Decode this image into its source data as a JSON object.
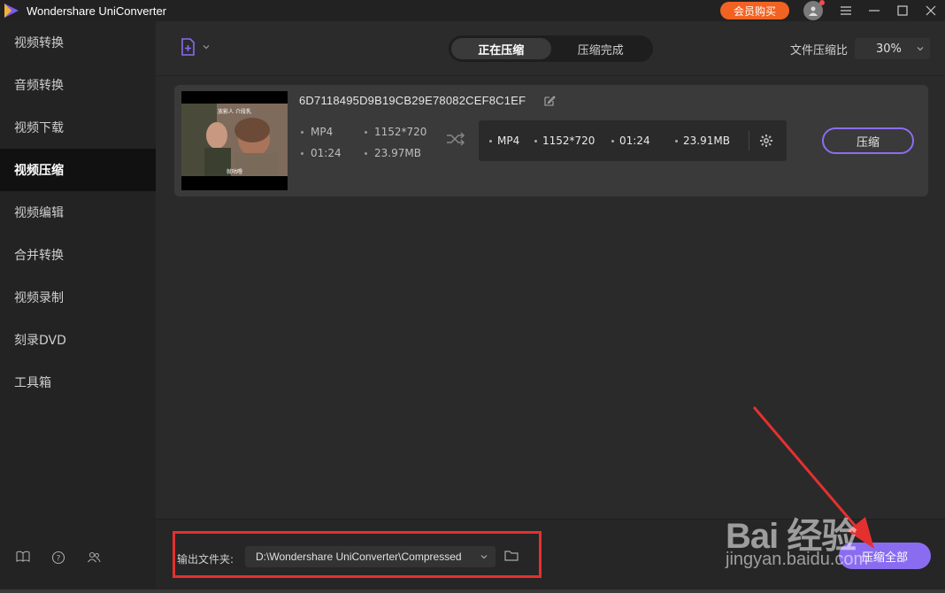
{
  "window": {
    "title": "Wondershare UniConverter",
    "vip_label": "会员购买"
  },
  "sidebar": {
    "items": [
      {
        "label": "视频转换",
        "active": false
      },
      {
        "label": "音频转换",
        "active": false
      },
      {
        "label": "视频下载",
        "active": false
      },
      {
        "label": "视频压缩",
        "active": true
      },
      {
        "label": "视频编辑",
        "active": false
      },
      {
        "label": "合并转换",
        "active": false
      },
      {
        "label": "视频录制",
        "active": false
      },
      {
        "label": "刻录DVD",
        "active": false
      },
      {
        "label": "工具箱",
        "active": false
      }
    ],
    "footer_icons": [
      "book-icon",
      "help-icon",
      "users-icon"
    ]
  },
  "toolbar": {
    "tabs": [
      {
        "label": "正在压缩",
        "active": true
      },
      {
        "label": "压缩完成",
        "active": false
      }
    ],
    "ratio_label": "文件压缩比",
    "ratio_value": "30%"
  },
  "file": {
    "name": "6D7118495D9B19CB29E78082CEF8C1EF",
    "thumb_caption_top": "放影人 介段乳",
    "thumb_caption_bottom": "就咕噜",
    "source": {
      "format": "MP4",
      "resolution": "1152*720",
      "duration": "01:24",
      "size": "23.97MB"
    },
    "target": {
      "format": "MP4",
      "resolution": "1152*720",
      "duration": "01:24",
      "size": "23.91MB"
    },
    "compress_label": "压缩"
  },
  "bottom": {
    "output_label": "输出文件夹:",
    "output_path": "D:\\Wondershare UniConverter\\Compressed",
    "compress_all_label": "压缩全部"
  },
  "watermark": {
    "main": "Bai 经验",
    "sub": "jingyan.baidu.com"
  },
  "colors": {
    "accent": "#8a6cf0",
    "vip": "#f26222",
    "annotation": "#e53030"
  }
}
